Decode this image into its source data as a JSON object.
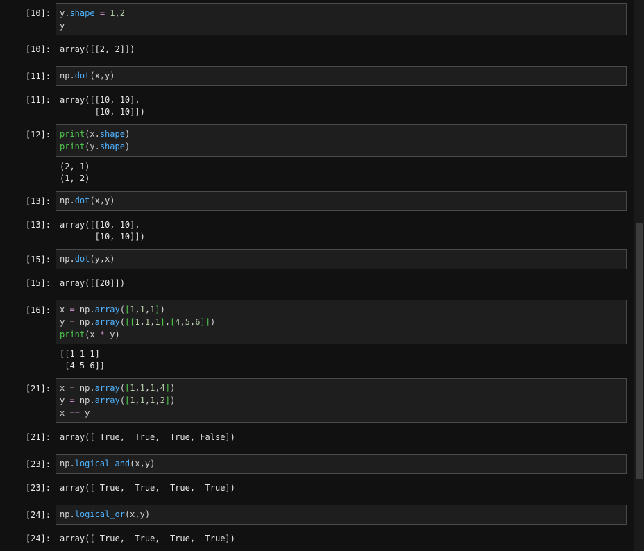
{
  "cells": [
    {
      "id": "c1",
      "prompt_in": "[10]:",
      "prompt_out": "[10]:",
      "code": "y.shape = 1,2\ny",
      "output": "array([[2, 2]])"
    },
    {
      "id": "c2",
      "prompt_in": "[11]:",
      "prompt_out": "[11]:",
      "code": "np.dot(x,y)",
      "output": "array([[10, 10],\n       [10, 10]])"
    },
    {
      "id": "c3",
      "prompt_in": "[12]:",
      "prompt_out": "",
      "code": "print(x.shape)\nprint(y.shape)",
      "output": "(2, 1)\n(1, 2)"
    },
    {
      "id": "c4",
      "prompt_in": "[13]:",
      "prompt_out": "[13]:",
      "code": "np.dot(x,y)",
      "output": "array([[10, 10],\n       [10, 10]])"
    },
    {
      "id": "c5",
      "prompt_in": "[15]:",
      "prompt_out": "[15]:",
      "code": "np.dot(y,x)",
      "output": "array([[20]])"
    },
    {
      "id": "c6",
      "prompt_in": "[16]:",
      "prompt_out": "",
      "code": "x = np.array([1,1,1])\ny = np.array([[1,1,1],[4,5,6]])\nprint(x * y)",
      "output": "[[1 1 1]\n [4 5 6]]"
    },
    {
      "id": "c7",
      "prompt_in": "[21]:",
      "prompt_out": "[21]:",
      "code": "x = np.array([1,1,1,4])\ny = np.array([1,1,1,2])\nx == y",
      "output": "array([ True,  True,  True, False])"
    },
    {
      "id": "c8",
      "prompt_in": "[23]:",
      "prompt_out": "[23]:",
      "code": "np.logical_and(x,y)",
      "output": "array([ True,  True,  True,  True])"
    },
    {
      "id": "c9",
      "prompt_in": "[24]:",
      "prompt_out": "[24]:",
      "code": "np.logical_or(x,y)",
      "output": "array([ True,  True,  True,  True])"
    }
  ],
  "colors": {
    "background": "#111111",
    "cell_background": "#1e1e1e",
    "cell_border": "#4a4a4a",
    "attribute": "#4fb3ff",
    "builtin": "#4ec94e",
    "number": "#b5cea8",
    "operator": "#c586c0"
  }
}
